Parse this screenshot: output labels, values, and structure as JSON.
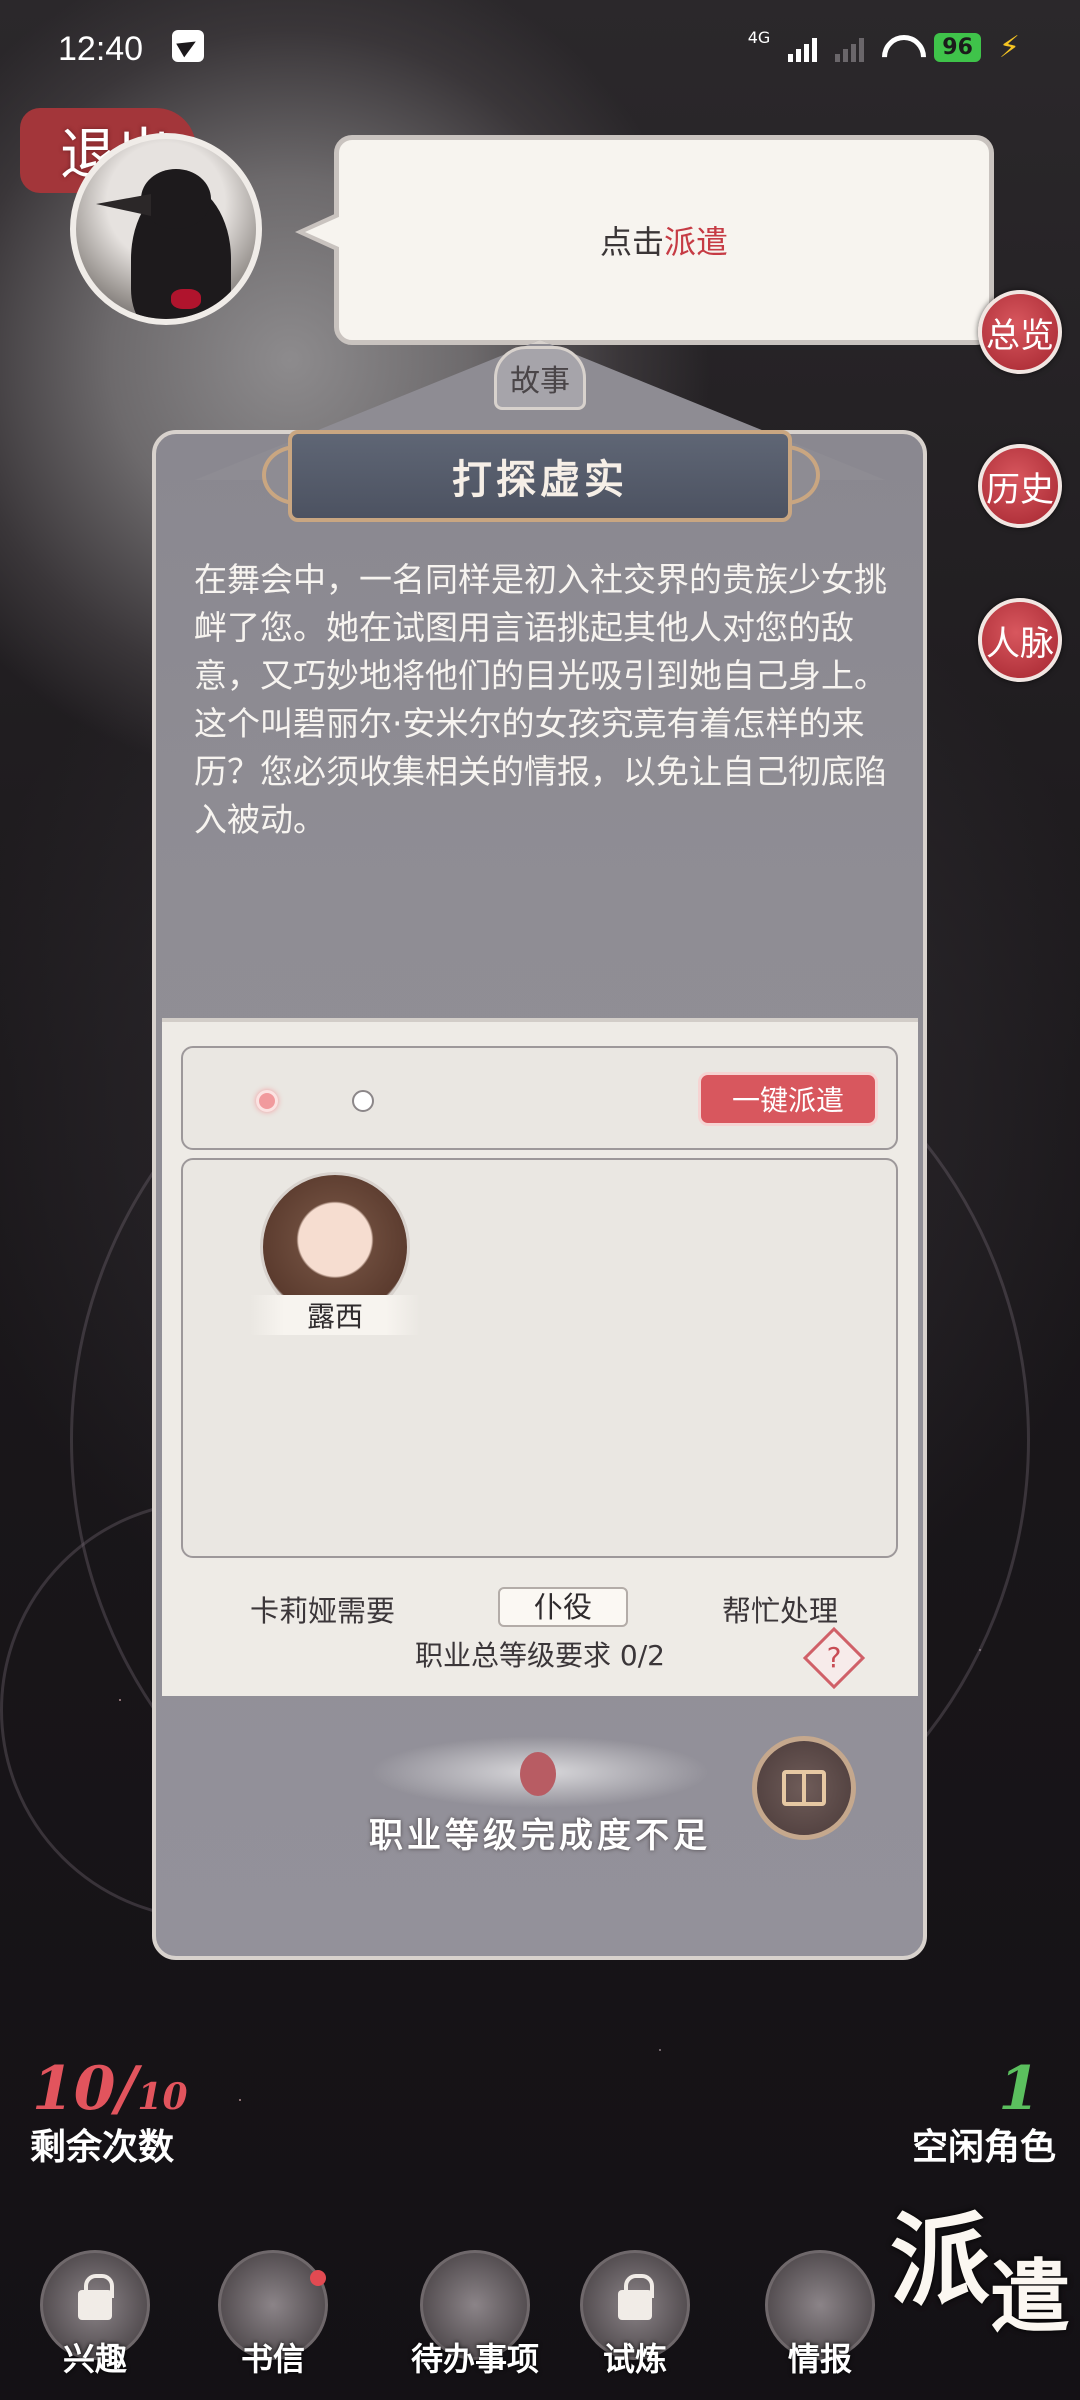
{
  "status_bar": {
    "time": "12:40",
    "network": "4G",
    "battery": "96"
  },
  "back": {
    "label": "退出"
  },
  "dialog": {
    "prefix": "点击",
    "highlight": "派遣"
  },
  "side_buttons": [
    "总览",
    "历史",
    "人脉"
  ],
  "story": {
    "tag": "故事",
    "title": "打探虚实",
    "body": "在舞会中，一名同样是初入社交界的贵族少女挑衅了您。她在试图用言语挑起其他人对您的敌意，又巧妙地将他们的目光吸引到她自己身上。这个叫碧丽尔·安米尔的女孩究竟有着怎样的来历？您必须收集相关的情报，以免让自己彻底陷入被动。"
  },
  "dispatch": {
    "one_click": "一键派遣",
    "character": {
      "name": "露西"
    },
    "requirement": {
      "prefix": "卡莉娅需要",
      "job": "仆役",
      "suffix": "帮忙处理",
      "level": "职业总等级要求 0/2"
    },
    "status": "职业等级完成度不足",
    "help": "?"
  },
  "counts": {
    "remaining": "10",
    "remaining_total": "10",
    "remaining_label": "剩余次数",
    "idle": "1",
    "idle_label": "空闲角色"
  },
  "nav": [
    {
      "label": "兴趣",
      "locked": true
    },
    {
      "label": "书信",
      "locked": false
    },
    {
      "label": "待办事项",
      "locked": false
    },
    {
      "label": "试炼",
      "locked": true
    },
    {
      "label": "情报",
      "locked": false
    }
  ],
  "page_title": {
    "first": "派",
    "second": "遣"
  }
}
